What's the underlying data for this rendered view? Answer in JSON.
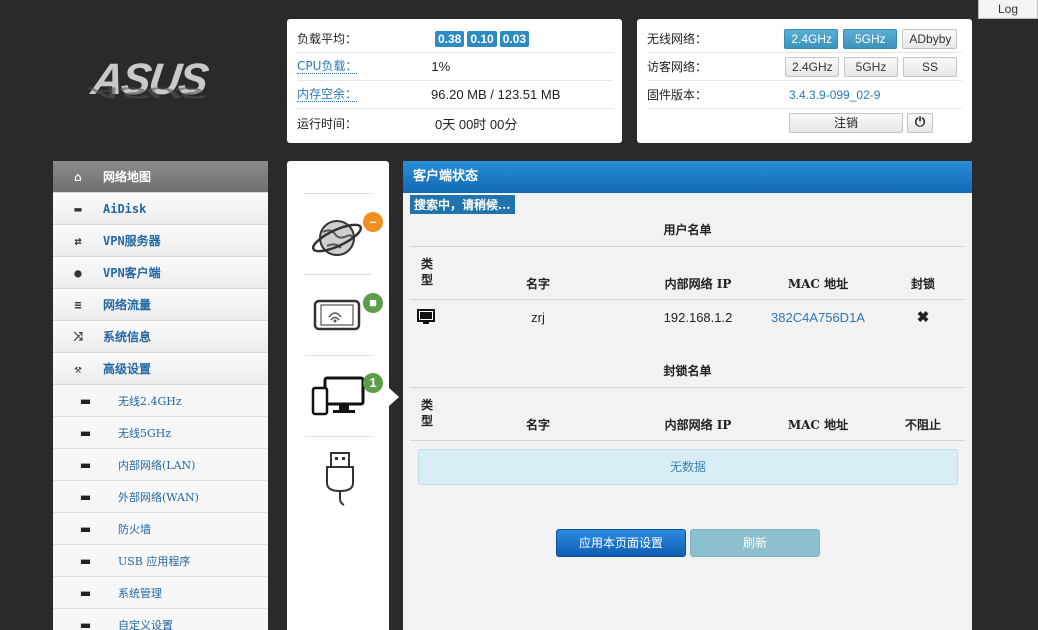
{
  "header": {
    "logo": "ASUS",
    "log_button": "Log"
  },
  "system": {
    "load_label": "负载平均：",
    "load_values": [
      "0.38",
      "0.10",
      "0.03"
    ],
    "cpu_label": "CPU负载：",
    "cpu_value": "1%",
    "mem_label": "内存空余：",
    "mem_value": "96.20 MB / 123.51 MB",
    "uptime_label": "运行时间：",
    "uptime_value": "0天 00时 00分"
  },
  "network": {
    "wireless_label": "无线网络：",
    "wireless_buttons": [
      "2.4GHz",
      "5GHz",
      "ADbyby"
    ],
    "guest_label": "访客网络：",
    "guest_buttons": [
      "2.4GHz",
      "5GHz",
      "SS"
    ],
    "firmware_label": "固件版本：",
    "firmware_value": "3.4.3.9-099_02-9",
    "logout_label": "注销",
    "power_icon": "power-icon"
  },
  "sidebar": {
    "items": [
      {
        "label": "网络地图",
        "icon": "home-icon",
        "active": true
      },
      {
        "label": "AiDisk",
        "icon": "disk-icon"
      },
      {
        "label": "VPN服务器",
        "icon": "sync-icon"
      },
      {
        "label": "VPN客户端",
        "icon": "globe-icon"
      },
      {
        "label": "网络流量",
        "icon": "list-icon"
      },
      {
        "label": "系统信息",
        "icon": "random-icon"
      },
      {
        "label": "高级设置",
        "icon": "wrench-icon"
      }
    ],
    "sub_items": [
      "无线2.4GHz",
      "无线5GHz",
      "内部网络(LAN)",
      "外部网络(WAN)",
      "防火墙",
      "USB 应用程序",
      "系统管理",
      "自定义设置"
    ]
  },
  "icon_column": {
    "internet_badge": "–",
    "wifi_badge_icon": "lock-icon",
    "clients_badge": "1"
  },
  "main": {
    "title": "客户端状态",
    "scan_status": "搜索中，请稍候...",
    "user_list_title": "用户名单",
    "block_list_title": "封锁名单",
    "user_columns": [
      "类型",
      "名字",
      "内部网络 IP",
      "MAC 地址",
      "封锁"
    ],
    "block_columns": [
      "类型",
      "名字",
      "内部网络 IP",
      "MAC 地址",
      "不阻止"
    ],
    "clients": [
      {
        "type_icon": "desktop-icon",
        "name": "zrj",
        "ip": "192.168.1.2",
        "mac": "382C4A756D1A",
        "block_icon": "close-icon"
      }
    ],
    "no_data": "无数据",
    "apply_button": "应用本页面设置",
    "refresh_button": "刷新"
  },
  "colors": {
    "accent": "#1268b4",
    "badge": "#2c8bc0",
    "link": "#2b79b5"
  }
}
